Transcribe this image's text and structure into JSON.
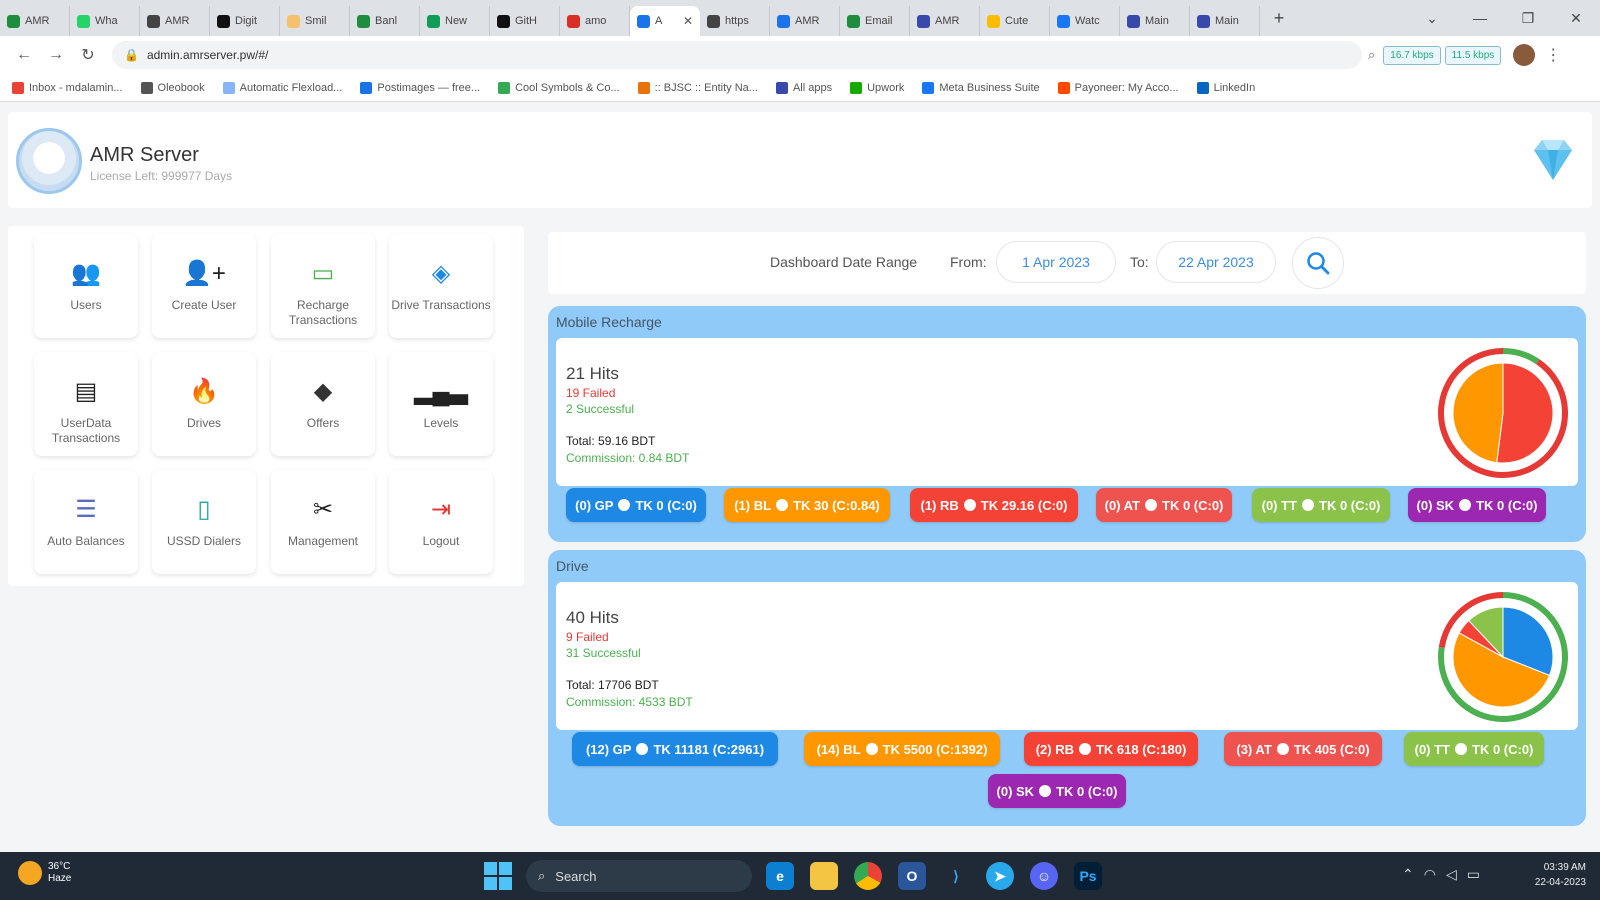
{
  "browser": {
    "tabs": [
      {
        "label": "AMR",
        "color": "#1e8e3e"
      },
      {
        "label": "Wha",
        "color": "#25d366"
      },
      {
        "label": "AMR",
        "color": "#444444"
      },
      {
        "label": "Digit",
        "color": "#111111"
      },
      {
        "label": "Smil",
        "color": "#f5c16c"
      },
      {
        "label": "Banl",
        "color": "#1e8e3e"
      },
      {
        "label": "New",
        "color": "#0f9d58"
      },
      {
        "label": "GitH",
        "color": "#111111"
      },
      {
        "label": "amo",
        "color": "#d93025"
      },
      {
        "label": "A",
        "color": "#1a73e8",
        "active": true
      },
      {
        "label": "https",
        "color": "#444444"
      },
      {
        "label": "AMR",
        "color": "#1a73e8"
      },
      {
        "label": "Email",
        "color": "#1e8e3e"
      },
      {
        "label": "AMR",
        "color": "#3949ab"
      },
      {
        "label": "Cute",
        "color": "#fbbc04"
      },
      {
        "label": "Watc",
        "color": "#1877f2"
      },
      {
        "label": "Main",
        "color": "#3949ab"
      },
      {
        "label": "Main",
        "color": "#3949ab"
      }
    ],
    "new_tab_label": "+",
    "url": "admin.amrserver.pw/#/",
    "speed_down": "16.7 kbps",
    "speed_up": "11.5 kbps",
    "bookmarks": [
      {
        "label": "Inbox - mdalamin...",
        "color": "#ea4335"
      },
      {
        "label": "Oleobook",
        "color": "#555555"
      },
      {
        "label": "Automatic Flexload...",
        "color": "#8ab4f8"
      },
      {
        "label": "Postimages — free...",
        "color": "#1a73e8"
      },
      {
        "label": "Cool Symbols & Co...",
        "color": "#34a853"
      },
      {
        "label": ":: BJSC :: Entity Na...",
        "color": "#e8710a"
      },
      {
        "label": "All apps",
        "color": "#3949ab"
      },
      {
        "label": "Upwork",
        "color": "#14a800"
      },
      {
        "label": "Meta Business Suite",
        "color": "#1877f2"
      },
      {
        "label": "Payoneer: My Acco...",
        "color": "#ff4800"
      },
      {
        "label": "LinkedIn",
        "color": "#0a66c2"
      }
    ]
  },
  "app": {
    "title": "AMR Server",
    "license": "License Left: 999977 Days",
    "menu": [
      {
        "label": "Users",
        "icon": "users-icon",
        "glyph": "👥",
        "color": "#e91e63"
      },
      {
        "label": "Create User",
        "icon": "add-user-icon",
        "glyph": "👤+",
        "color": "#222222"
      },
      {
        "label": "Recharge Transactions",
        "icon": "card-icon",
        "glyph": "▭",
        "color": "#4caf50"
      },
      {
        "label": "Drive Transactions",
        "icon": "tag-icon",
        "glyph": "◈",
        "color": "#1e88e5"
      },
      {
        "label": "UserData Transactions",
        "icon": "document-icon",
        "glyph": "▤",
        "color": "#222222"
      },
      {
        "label": "Drives",
        "icon": "fire-icon",
        "glyph": "🔥",
        "color": "#ff5722"
      },
      {
        "label": "Offers",
        "icon": "tags-icon",
        "glyph": "◆",
        "color": "#333333"
      },
      {
        "label": "Levels",
        "icon": "levels-icon",
        "glyph": "▂▄▃",
        "color": "#222222"
      },
      {
        "label": "Auto Balances",
        "icon": "list-icon",
        "glyph": "☰",
        "color": "#5c6bc0"
      },
      {
        "label": "USSD Dialers",
        "icon": "phone-icon",
        "glyph": "▯",
        "color": "#26a69a"
      },
      {
        "label": "Management",
        "icon": "tools-icon",
        "glyph": "✂",
        "color": "#222222"
      },
      {
        "label": "Logout",
        "icon": "logout-icon",
        "glyph": "⇥",
        "color": "#e53935"
      }
    ],
    "date_range": {
      "label": "Dashboard Date Range",
      "from_label": "From:",
      "from_value": "1 Apr 2023",
      "to_label": "To:",
      "to_value": "22 Apr 2023"
    },
    "sections": [
      {
        "key": "mobile",
        "title": "Mobile Recharge",
        "hits": "21 Hits",
        "failed": "19 Failed",
        "successful": "2 Successful",
        "total": "Total: 59.16 BDT",
        "commission": "Commission: 0.84 BDT",
        "pie": {
          "failed": 19,
          "successful": 2,
          "slices": [
            {
              "value": 0.52,
              "color": "#f44336"
            },
            {
              "value": 0.48,
              "color": "#ff9800"
            }
          ]
        },
        "chips": [
          {
            "prefix": "(0) GP",
            "suffix": "TK 0 (C:0)",
            "color": "#1e88e5"
          },
          {
            "prefix": "(1) BL",
            "suffix": "TK 30 (C:0.84)",
            "color": "#ff9800"
          },
          {
            "prefix": "(1) RB",
            "suffix": "TK 29.16 (C:0)",
            "color": "#f44336"
          },
          {
            "prefix": "(0) AT",
            "suffix": "TK 0 (C:0)",
            "color": "#ef5350"
          },
          {
            "prefix": "(0) TT",
            "suffix": "TK 0 (C:0)",
            "color": "#8bc34a"
          },
          {
            "prefix": "(0) SK",
            "suffix": "TK 0 (C:0)",
            "color": "#9c27b0"
          }
        ]
      },
      {
        "key": "drive",
        "title": "Drive",
        "hits": "40 Hits",
        "failed": "9 Failed",
        "successful": "31 Successful",
        "total": "Total: 17706 BDT",
        "commission": "Commission: 4533 BDT",
        "pie": {
          "failed": 9,
          "successful": 31,
          "slices": [
            {
              "value": 0.31,
              "color": "#1e88e5"
            },
            {
              "value": 0.52,
              "color": "#ff9800"
            },
            {
              "value": 0.05,
              "color": "#f44336"
            },
            {
              "value": 0.12,
              "color": "#8bc34a"
            }
          ]
        },
        "chips": [
          {
            "prefix": "(12) GP",
            "suffix": "TK 11181 (C:2961)",
            "color": "#1e88e5"
          },
          {
            "prefix": "(14) BL",
            "suffix": "TK 5500 (C:1392)",
            "color": "#ff9800"
          },
          {
            "prefix": "(2) RB",
            "suffix": "TK 618 (C:180)",
            "color": "#f44336"
          },
          {
            "prefix": "(3) AT",
            "suffix": "TK 405 (C:0)",
            "color": "#ef5350"
          },
          {
            "prefix": "(0) TT",
            "suffix": "TK 0 (C:0)",
            "color": "#8bc34a"
          },
          {
            "prefix": "(0) SK",
            "suffix": "TK 0 (C:0)",
            "color": "#9c27b0"
          }
        ]
      }
    ]
  },
  "taskbar": {
    "temperature": "36°C",
    "weather": "Haze",
    "search_label": "Search",
    "time": "03:39 AM",
    "date": "22-04-2023"
  }
}
